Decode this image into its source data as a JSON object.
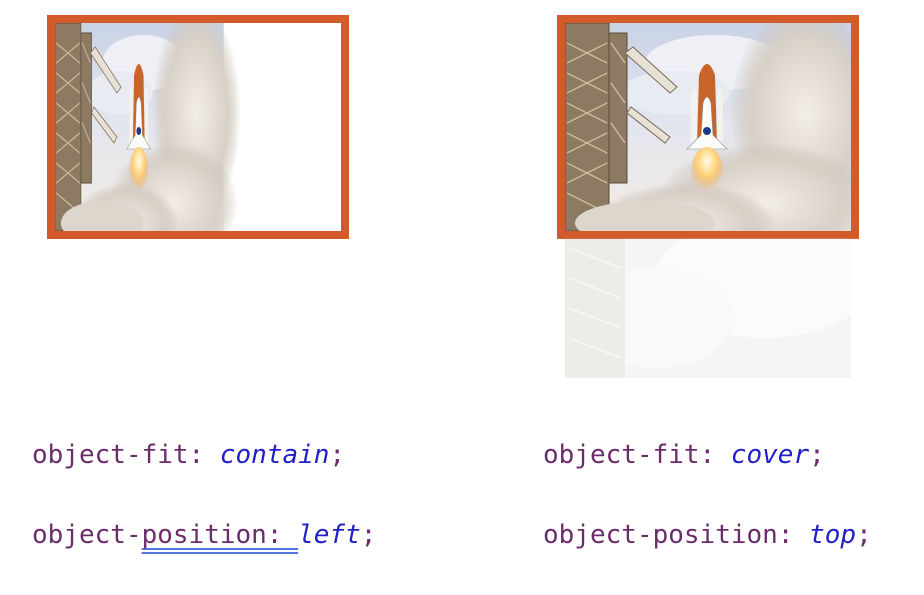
{
  "examples": [
    {
      "fit_property": "object-fit: ",
      "fit_value": "contain",
      "position_property_a": "object-",
      "position_property_b": "position: ",
      "position_value": "left",
      "terminator": ";"
    },
    {
      "fit_property": "object-fit: ",
      "fit_value": "cover",
      "position_property_a": "object-",
      "position_property_b": "position: ",
      "position_value": "top",
      "terminator": ";"
    }
  ],
  "colors": {
    "frame_border": "#d35a2a",
    "code_property": "#6b2d6b",
    "code_value": "#2020c8",
    "spellcheck_underline": "#5577dd"
  }
}
